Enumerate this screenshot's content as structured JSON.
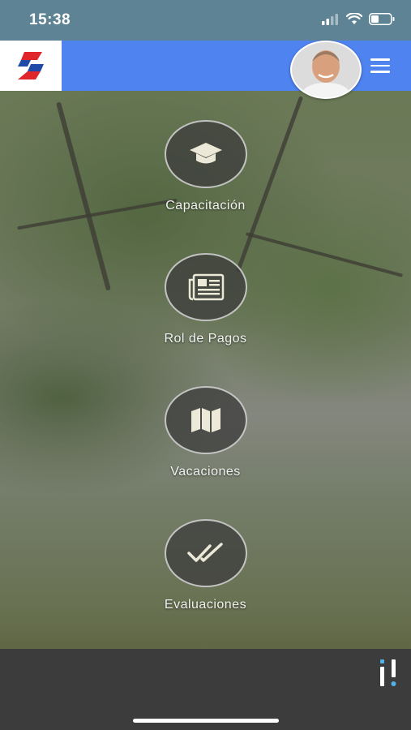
{
  "status_bar": {
    "time": "15:38"
  },
  "colors": {
    "header": "#4f83f0",
    "status_bar": "#5e8394",
    "bottom_bar": "#3c3c3c",
    "logo_red": "#e0262b",
    "logo_blue": "#1f4aa8",
    "info_accent": "#4fb3e8"
  },
  "header": {
    "logo_icon": "company-logo",
    "avatar_icon": "user-avatar",
    "menu_icon": "hamburger-menu-icon"
  },
  "menu": [
    {
      "label": "Capacitación",
      "icon": "graduation-cap-icon"
    },
    {
      "label": "Rol de Pagos",
      "icon": "newspaper-icon"
    },
    {
      "label": "Vacaciones",
      "icon": "map-icon"
    },
    {
      "label": "Evaluaciones",
      "icon": "double-check-icon"
    }
  ],
  "bottom_bar": {
    "info_icon": "info-exclamation-icon"
  }
}
